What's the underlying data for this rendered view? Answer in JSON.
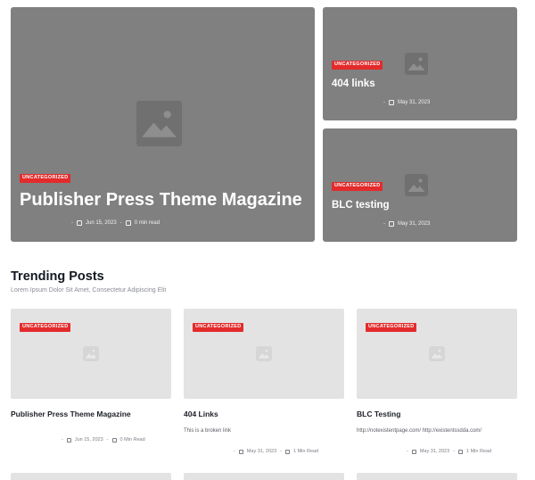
{
  "hero": {
    "main": {
      "badge": "UNCATEGORIZED",
      "title": "Publisher Press Theme Magazine",
      "date": "Jun 15, 2023",
      "read": "0 min read",
      "icon": "image-placeholder-icon"
    },
    "side": [
      {
        "badge": "UNCATEGORIZED",
        "title": "404 links",
        "date": "May 31, 2023",
        "icon": "image-placeholder-icon"
      },
      {
        "badge": "UNCATEGORIZED",
        "title": "BLC testing",
        "date": "May 31, 2023",
        "icon": "image-placeholder-icon"
      }
    ]
  },
  "trending": {
    "title": "Trending Posts",
    "subtitle": "Lorem Ipsum Dolor Sit Amet, Consectetur Adipiscing Elit",
    "cards": [
      {
        "badge": "UNCATEGORIZED",
        "title": "Publisher Press Theme Magazine",
        "excerpt": "",
        "date": "Jun 15, 2023",
        "read": "0 Min Read"
      },
      {
        "badge": "UNCATEGORIZED",
        "title": "404 Links",
        "excerpt": "This is a broken link",
        "date": "May 31, 2023",
        "read": "1 Min Read"
      },
      {
        "badge": "UNCATEGORIZED",
        "title": "BLC Testing",
        "excerpt": "http://notexistentpage.com/ http://existentssdda.com/",
        "date": "May 31, 2023",
        "read": "1 Min Read"
      }
    ]
  },
  "colors": {
    "badge": "#e32b2b",
    "hero_bg": "#808080",
    "card_bg": "#e3e3e3"
  },
  "separator": "-"
}
